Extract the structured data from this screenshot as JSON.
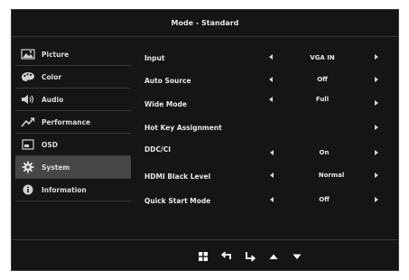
{
  "header": {
    "title": "Mode - Standard"
  },
  "sidebar": {
    "items": [
      {
        "label": "Picture",
        "icon": "picture-icon"
      },
      {
        "label": "Color",
        "icon": "palette-icon"
      },
      {
        "label": "Audio",
        "icon": "speaker-icon"
      },
      {
        "label": "Performance",
        "icon": "performance-graph-icon"
      },
      {
        "label": "OSD",
        "icon": "osd-icon"
      },
      {
        "label": "System",
        "icon": "gear-icon",
        "selected": true
      },
      {
        "label": "Information",
        "icon": "info-icon"
      }
    ]
  },
  "settings": {
    "input": {
      "label": "Input",
      "value": "VGA IN"
    },
    "auto_source": {
      "label": "Auto Source",
      "value": "Off"
    },
    "wide_mode": {
      "label": "Wide Mode",
      "value": "Full"
    },
    "hot_key": {
      "label": "Hot Key Assignment"
    },
    "ddc_ci": {
      "label": "DDC/CI",
      "value": "On"
    },
    "hdmi_black": {
      "label": "HDMI Black Level",
      "value": "Normal"
    },
    "quick_start": {
      "label": "Quick Start Mode",
      "value": "Off"
    }
  },
  "hotkeys": [
    "menu-grid-icon",
    "back-icon",
    "enter-icon",
    "up-arrow-icon",
    "down-arrow-icon"
  ],
  "colors": {
    "background": "#151515",
    "selected": "#474747",
    "divider": "#3a3a3a",
    "text": "#e6e6e6"
  }
}
